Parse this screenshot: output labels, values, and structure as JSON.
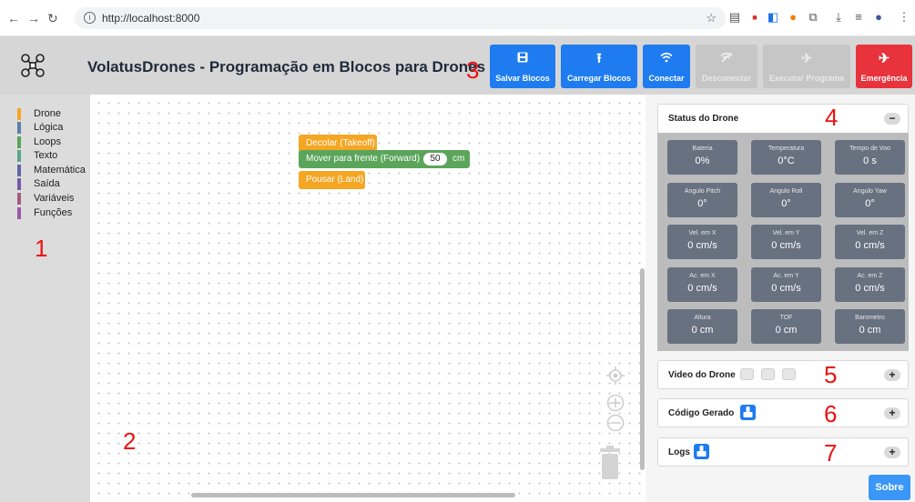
{
  "browser": {
    "url": "http://localhost:8000"
  },
  "header": {
    "title": "VolatusDrones - Programação em Blocos para Drones",
    "buttons": [
      {
        "label": "Salvar Blocos",
        "icon": "save-icon"
      },
      {
        "label": "Carregar Blocos",
        "icon": "upload-icon"
      },
      {
        "label": "Conectar",
        "icon": "wifi-icon"
      },
      {
        "label": "Desconectar",
        "icon": "wifi-off-icon"
      },
      {
        "label": "Executar Programa",
        "icon": "takeoff-icon"
      },
      {
        "label": "Emergência",
        "icon": "landing-icon"
      }
    ]
  },
  "markers": [
    "1",
    "2",
    "3",
    "4",
    "5",
    "6",
    "7"
  ],
  "toolbox": {
    "categories": [
      {
        "label": "Drone",
        "color": "#f5a623"
      },
      {
        "label": "Lógica",
        "color": "#5b80a5"
      },
      {
        "label": "Loops",
        "color": "#5ba55b"
      },
      {
        "label": "Texto",
        "color": "#5ba58c"
      },
      {
        "label": "Matemática",
        "color": "#5b67a5"
      },
      {
        "label": "Saída",
        "color": "#745ba5"
      },
      {
        "label": "Variáveis",
        "color": "#a55b80"
      },
      {
        "label": "Funções",
        "color": "#995ba5"
      }
    ]
  },
  "workspace": {
    "blocks": [
      {
        "label": "Decolar (Takeoff)"
      },
      {
        "label": "Mover para frente (Forward)",
        "value": "50",
        "unit": "cm"
      },
      {
        "label": "Pousar (Land)"
      }
    ]
  },
  "status": {
    "title": "Status do Drone",
    "toggle": "−",
    "tiles": [
      {
        "label": "Bateria",
        "value": "0%"
      },
      {
        "label": "Temperatura",
        "value": "0°C"
      },
      {
        "label": "Tempo de Voo",
        "value": "0 s"
      },
      {
        "label": "Angulo Pitch",
        "value": "0°"
      },
      {
        "label": "Angulo Roll",
        "value": "0°"
      },
      {
        "label": "Angulo Yaw",
        "value": "0°"
      },
      {
        "label": "Vel. em X",
        "value": "0 cm/s"
      },
      {
        "label": "Vel. em Y",
        "value": "0 cm/s"
      },
      {
        "label": "Vel. em Z",
        "value": "0 cm/s"
      },
      {
        "label": "Ac. em X",
        "value": "0 cm/s"
      },
      {
        "label": "Ac. em Y",
        "value": "0 cm/s"
      },
      {
        "label": "Ac. em Z",
        "value": "0 cm/s"
      },
      {
        "label": "Altura",
        "value": "0 cm"
      },
      {
        "label": "TOF",
        "value": "0 cm"
      },
      {
        "label": "Barometro",
        "value": "0 cm"
      }
    ]
  },
  "video": {
    "title": "Video do Drone",
    "toggle": "+"
  },
  "code": {
    "title": "Código Gerado",
    "toggle": "+"
  },
  "logs": {
    "title": "Logs",
    "toggle": "+"
  },
  "about": {
    "label": "Sobre"
  }
}
